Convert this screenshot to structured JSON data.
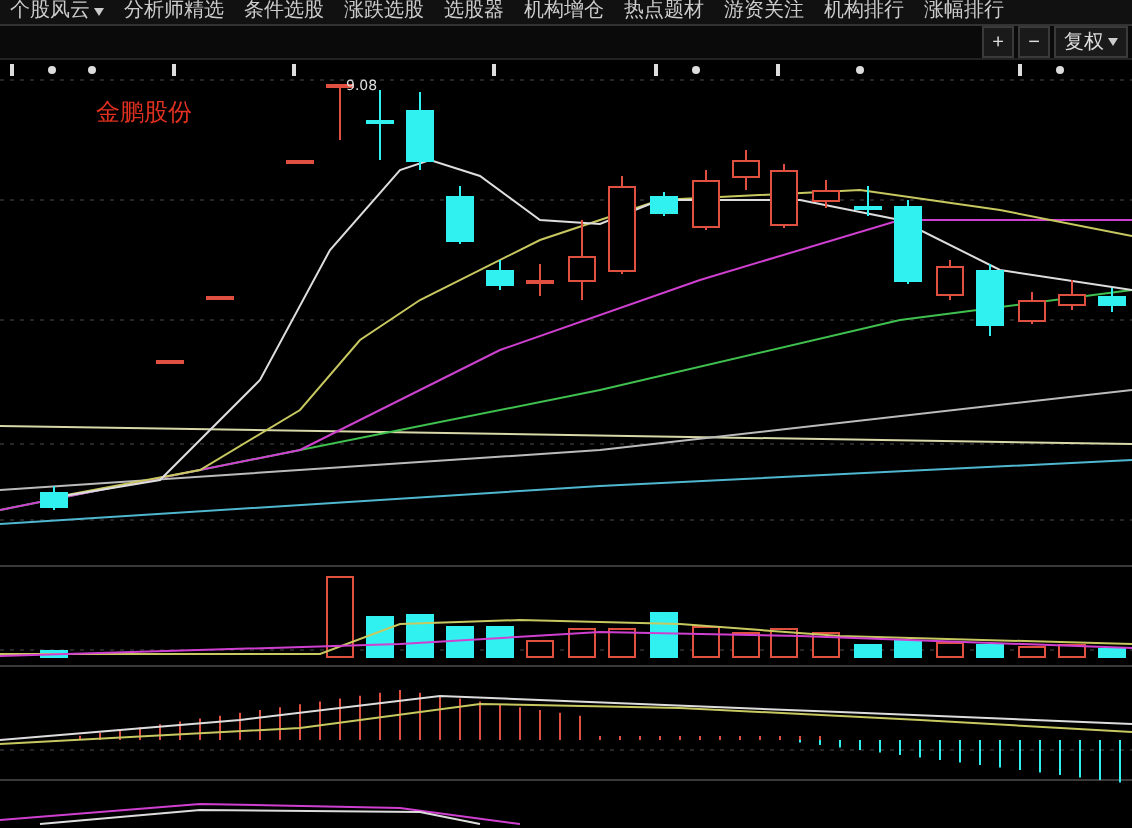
{
  "menu": [
    {
      "label": "个股风云",
      "dropdown": true
    },
    {
      "label": "分析师精选",
      "dropdown": false
    },
    {
      "label": "条件选股",
      "dropdown": false
    },
    {
      "label": "涨跌选股",
      "dropdown": false
    },
    {
      "label": "选股器",
      "dropdown": false
    },
    {
      "label": "机构增仓",
      "dropdown": false
    },
    {
      "label": "热点题材",
      "dropdown": false
    },
    {
      "label": "游资关注",
      "dropdown": false
    },
    {
      "label": "机构排行",
      "dropdown": false
    },
    {
      "label": "涨幅排行",
      "dropdown": false
    }
  ],
  "toolbar": [
    {
      "label": "+",
      "dropdown": false
    },
    {
      "label": "−",
      "dropdown": false
    },
    {
      "label": "复权",
      "dropdown": true
    }
  ],
  "chart": {
    "stock_name": "金鹏股份",
    "high_marker": "9.08"
  }
}
